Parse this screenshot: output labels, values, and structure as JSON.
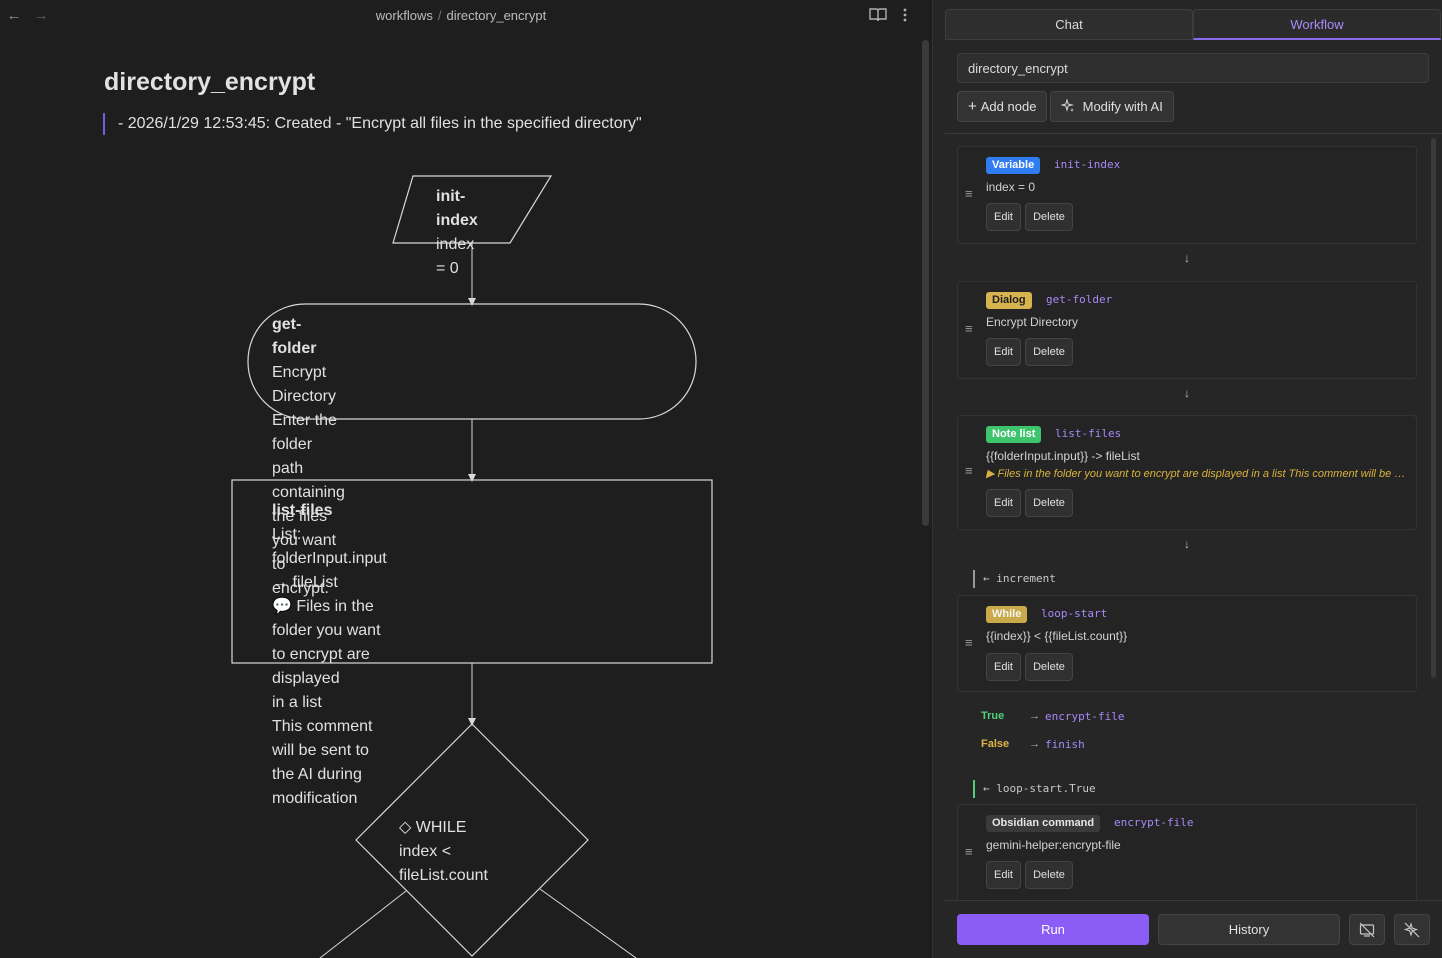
{
  "breadcrumb": {
    "folder": "workflows",
    "separator": "/",
    "file": "directory_encrypt"
  },
  "document": {
    "title": "directory_encrypt",
    "log_line": "- 2026/1/29 12:53:45: Created - \"Encrypt all files in the specified directory\""
  },
  "flowchart": {
    "init_index": {
      "name": "init-index",
      "line1": "index = 0"
    },
    "get_folder": {
      "name": "get-folder",
      "line1": "Encrypt Directory",
      "line2": "Enter the folder path containing the files you want to",
      "line3": "encrypt."
    },
    "list_files": {
      "name": "list-files",
      "line1": "List: folderInput.input",
      "line2": "→  fileList",
      "line3": "💬 Files in the folder you want to encrypt are displayed",
      "line4": "in a list",
      "line5": "This comment will be sent to the AI during modification"
    },
    "while": {
      "name": "◇ WHILE",
      "line1": "index < fileList.count"
    }
  },
  "panel": {
    "tabs": [
      {
        "label": "Chat",
        "active": false
      },
      {
        "label": "Workflow",
        "active": true
      }
    ],
    "workflow_name": "directory_encrypt",
    "add_node_label": "Add node",
    "modify_ai_label": "Modify with AI",
    "edit_label": "Edit",
    "delete_label": "Delete",
    "arrow": "↓",
    "nodes": [
      {
        "type": "Variable",
        "id": "init-index",
        "desc": "index = 0"
      },
      {
        "type": "Dialog",
        "id": "get-folder",
        "desc": "Encrypt Directory"
      },
      {
        "type": "Note list",
        "id": "list-files",
        "desc": "{{folderInput.input}} -> fileList",
        "comment": "▶ Files in the folder you want to encrypt are displayed in a list This comment will be sent to the AI during modification"
      },
      {
        "type": "While",
        "id": "loop-start",
        "desc": "{{index}} < {{fileList.count}}",
        "incoming": "← increment",
        "branches": {
          "true_label": "True",
          "true_target": "encrypt-file",
          "false_label": "False",
          "false_target": "finish",
          "arrow": "→"
        }
      },
      {
        "type": "Obsidian command",
        "id": "encrypt-file",
        "desc": "gemini-helper:encrypt-file",
        "incoming": "← loop-start.True"
      }
    ],
    "run_label": "Run",
    "history_label": "History"
  },
  "colors": {
    "accent": "#8b5cf6",
    "variable_badge": "#2f7df0",
    "dialog_badge": "#d8b451",
    "notelist_badge": "#3ec46d",
    "while_badge": "#c9a94a",
    "command_badge": "#3a3a3a",
    "true_color": "#4fd07a",
    "false_color": "#e0b24a"
  },
  "icons": [
    "back-arrow-icon",
    "forward-arrow-icon",
    "book-icon",
    "more-vertical-icon",
    "plus-icon",
    "sparkles-icon",
    "drag-handle-icon",
    "no-display-icon",
    "no-ai-icon"
  ]
}
